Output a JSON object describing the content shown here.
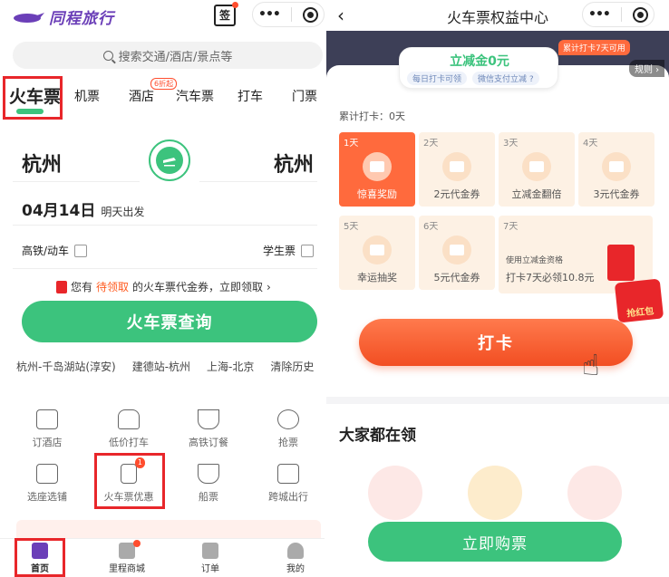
{
  "colors": {
    "accent_green": "#3cc37d",
    "brand_purple": "#6b3fb8",
    "alert_red": "#e8262a",
    "orange": "#ff6a3d"
  },
  "left": {
    "app_name": "同程旅行",
    "sign_label": "签",
    "capsule_more": "•••",
    "search_placeholder": "搜索交通/酒店/景点等",
    "categories": [
      {
        "label": "火车票",
        "active": true
      },
      {
        "label": "机票"
      },
      {
        "label": "酒店",
        "badge": "6折起"
      },
      {
        "label": "汽车票"
      },
      {
        "label": "打车"
      },
      {
        "label": "门票"
      }
    ],
    "from_city": "杭州",
    "to_city": "杭州",
    "date": "04月14日",
    "date_note": "明天出发",
    "option_highspeed": "高铁/动车",
    "option_student": "学生票",
    "coupon_pre": "您有",
    "coupon_highlight": "待领取",
    "coupon_post": "的火车票代金券，立即领取",
    "coupon_arrow": "›",
    "query_button": "火车票查询",
    "history": [
      "杭州-千岛湖站(淳安)",
      "建德站-杭州",
      "上海-北京",
      "清除历史"
    ],
    "services": [
      {
        "label": "订酒店",
        "icon": "hotel-icon"
      },
      {
        "label": "低价打车",
        "icon": "car-icon"
      },
      {
        "label": "高铁订餐",
        "icon": "meal-icon"
      },
      {
        "label": "抢票",
        "icon": "stopwatch-icon"
      },
      {
        "label": "选座选铺",
        "icon": "seat-icon"
      },
      {
        "label": "火车票优惠",
        "icon": "voucher-icon",
        "badge": "1"
      },
      {
        "label": "船票",
        "icon": "ship-icon"
      },
      {
        "label": "跨城出行",
        "icon": "bus-icon"
      }
    ],
    "tabs": [
      {
        "label": "首页",
        "icon": "home-icon",
        "active": true
      },
      {
        "label": "里程商城",
        "icon": "gift-icon",
        "dot": true
      },
      {
        "label": "订单",
        "icon": "order-icon"
      },
      {
        "label": "我的",
        "icon": "user-icon"
      }
    ]
  },
  "right": {
    "title": "火车票权益中心",
    "back": "‹",
    "capsule_more": "•••",
    "discount_main": "立减金0元",
    "pill_sub1": "每日打卡可领",
    "pill_sub2": "微信支付立减 ?",
    "ribbon": "累计打卡7天可用",
    "rules": "规则 ›",
    "days_counter": "累计打卡：0天",
    "rewards": [
      {
        "day": "1天",
        "label": "惊喜奖励"
      },
      {
        "day": "2天",
        "label": "2元代金券"
      },
      {
        "day": "3天",
        "label": "立减金翻倍"
      },
      {
        "day": "4天",
        "label": "3元代金券"
      },
      {
        "day": "5天",
        "label": "幸运抽奖"
      },
      {
        "day": "6天",
        "label": "5元代金券"
      },
      {
        "day": "7天",
        "note": "使用立减金资格",
        "label": "打卡7天必领10.8元"
      }
    ],
    "grab_label": "抢红包",
    "checkin_button": "打卡",
    "everyone_title": "大家都在领",
    "buy_button": "立即购票"
  }
}
